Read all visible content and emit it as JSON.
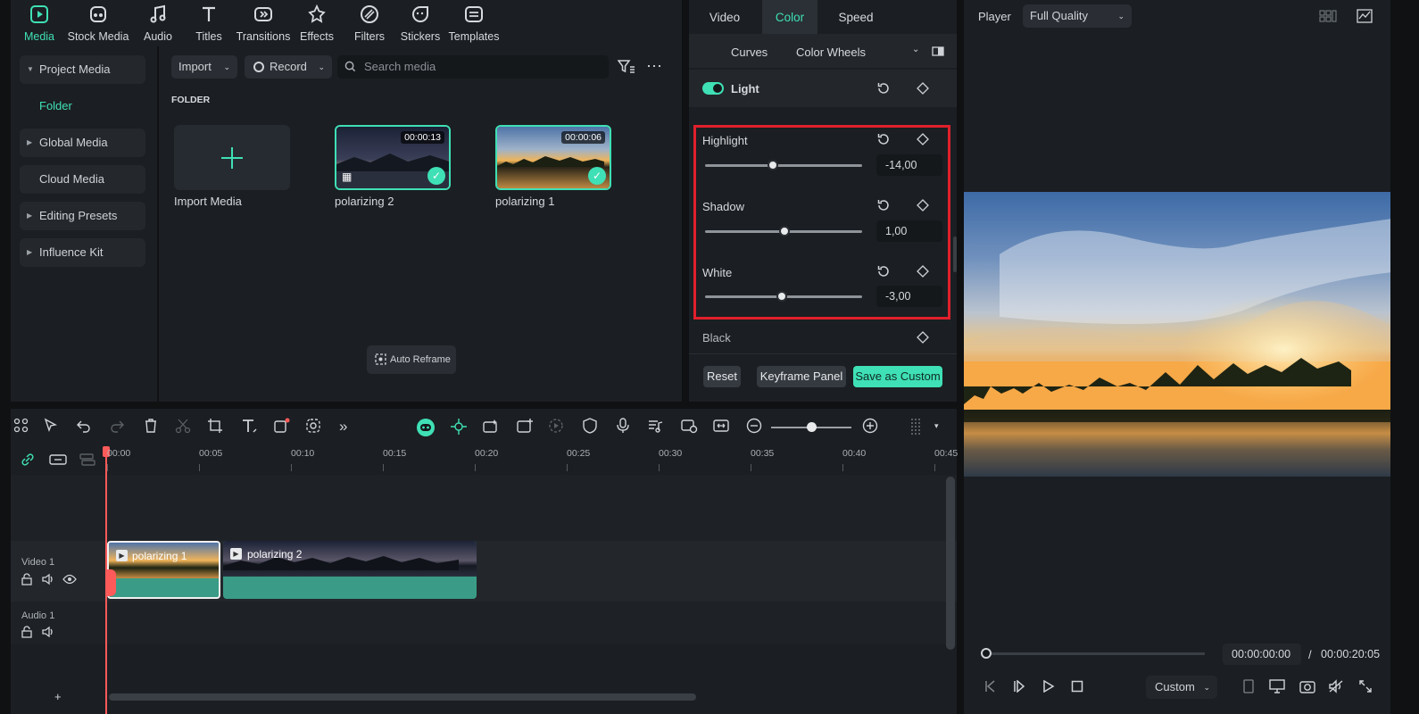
{
  "top_toolbar": {
    "items": [
      {
        "label": "Media",
        "icon": "media-icon",
        "active": true
      },
      {
        "label": "Stock Media",
        "icon": "stock-media-icon"
      },
      {
        "label": "Audio",
        "icon": "audio-icon"
      },
      {
        "label": "Titles",
        "icon": "titles-icon"
      },
      {
        "label": "Transitions",
        "icon": "transitions-icon"
      },
      {
        "label": "Effects",
        "icon": "effects-icon"
      },
      {
        "label": "Filters",
        "icon": "filters-icon"
      },
      {
        "label": "Stickers",
        "icon": "stickers-icon"
      },
      {
        "label": "Templates",
        "icon": "templates-icon"
      }
    ]
  },
  "sidebar": {
    "items": [
      {
        "label": "Project Media",
        "expanded": true
      },
      {
        "label": "Folder"
      },
      {
        "label": "Global Media"
      },
      {
        "label": "Cloud Media"
      },
      {
        "label": "Editing Presets"
      },
      {
        "label": "Influence Kit"
      }
    ]
  },
  "media": {
    "import_label": "Import",
    "record_label": "Record",
    "search_placeholder": "Search media",
    "folder_heading": "FOLDER",
    "import_media_label": "Import Media",
    "auto_reframe_label": "Auto Reframe",
    "clips": [
      {
        "name": "polarizing 2",
        "duration": "00:00:13"
      },
      {
        "name": "polarizing 1",
        "duration": "00:00:06"
      }
    ]
  },
  "color_panel": {
    "tabs": [
      "Video",
      "Color",
      "Speed"
    ],
    "active_tab": "Color",
    "subtabs": [
      "Curves",
      "Color Wheels"
    ],
    "section_label": "Light",
    "section_enabled": true,
    "adjustments": [
      {
        "label": "Highlight",
        "value": "-14,00",
        "level": -14
      },
      {
        "label": "Shadow",
        "value": "1,00",
        "level": 1
      },
      {
        "label": "White",
        "value": "-3,00",
        "level": -3
      }
    ],
    "black_label": "Black",
    "reset_label": "Reset",
    "keyframe_label": "Keyframe Panel",
    "save_label": "Save as Custom",
    "highlight_color": "#e0202c"
  },
  "player": {
    "label": "Player",
    "quality": "Full Quality",
    "current_time": "00:00:00:00",
    "separator": "/",
    "total_time": "00:00:20:05",
    "zoom_label": "Custom"
  },
  "timeline": {
    "ruler": [
      "00:00",
      "00:05",
      "00:10",
      "00:15",
      "00:20",
      "00:25",
      "00:30",
      "00:35",
      "00:40",
      "00:45"
    ],
    "video_track_label": "Video 1",
    "audio_track_label": "Audio 1",
    "clips": [
      {
        "name": "polarizing 1"
      },
      {
        "name": "polarizing 2"
      }
    ],
    "add_track": "+"
  },
  "colors": {
    "accent": "#3fe0b5",
    "panel": "#1b1e22",
    "playhead": "#ff5a5a",
    "clip_audio": "#3a9c86"
  }
}
